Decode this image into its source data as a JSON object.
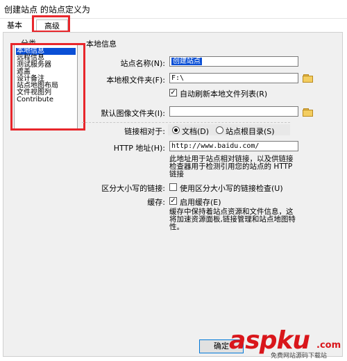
{
  "window": {
    "title": "创建站点 的站点定义为"
  },
  "tabs": [
    {
      "label": "基本"
    },
    {
      "label": "高级"
    }
  ],
  "category": {
    "label": "分类",
    "items": [
      "本地信息",
      "远程信息",
      "测试服务器",
      "遮盖",
      "设计备注",
      "站点地图布局",
      "文件视图列",
      "Contribute"
    ],
    "selected_index": 0
  },
  "section_title": "本地信息",
  "fields": {
    "site_name": {
      "label": "站点名称(N):",
      "value": "创建站点"
    },
    "local_root": {
      "label": "本地根文件夹(F):",
      "value": "F:\\"
    },
    "auto_refresh": {
      "label": "自动刷新本地文件列表(R)",
      "checked": true
    },
    "default_images": {
      "label": "默认图像文件夹(I):",
      "value": ""
    },
    "links_relative": {
      "label": "链接相对于:",
      "options": [
        "文档(D)",
        "站点根目录(S)"
      ],
      "selected_index": 0
    },
    "http_address": {
      "label": "HTTP 地址(H):",
      "value": "http://www.baidu.com/"
    },
    "http_desc_lines": [
      "此地址用于站点相对链接，以及供链接",
      "检查器用于检测引用您的站点的 HTTP",
      "链接"
    ],
    "case_sensitive": {
      "label": "区分大小写的链接:",
      "option": "使用区分大小写的链接检查(U)",
      "checked": false
    },
    "cache": {
      "label": "缓存:",
      "option": "启用缓存(E)",
      "checked": true
    },
    "cache_desc_lines": [
      "缓存中保持着站点资源和文件信息，这",
      "将加速资源面板,链接管理和站点地图特",
      "性。"
    ]
  },
  "buttons": {
    "ok": "确定"
  },
  "watermark": {
    "logo": "aspku",
    "suffix": ".com",
    "sub": "免费网站源码下载站"
  },
  "colors": {
    "highlight": "#e8262b",
    "selection": "#0a4fd6",
    "accent_border": "#0078d7"
  }
}
